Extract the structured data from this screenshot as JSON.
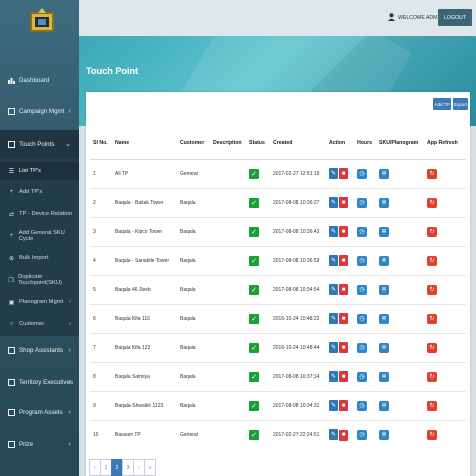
{
  "header": {
    "welcome": "WELCOME ADMIN",
    "logout": "LOGOUT"
  },
  "page": {
    "title": "Touch Point"
  },
  "toolbar": {
    "add": "Add TP",
    "export": "Export"
  },
  "sidebar": {
    "items": [
      {
        "label": "Dashboard"
      },
      {
        "label": "Campaign Mgmt"
      },
      {
        "label": "Touch Points"
      },
      {
        "label": "Shop Assistants"
      },
      {
        "label": "Territory Executives"
      },
      {
        "label": "Program Assets"
      },
      {
        "label": "Prize"
      }
    ],
    "sub": [
      {
        "label": "List TP's"
      },
      {
        "label": "Add TP's"
      },
      {
        "label": "TP - Device Relation"
      },
      {
        "label": "Add General SKU Cycle"
      },
      {
        "label": "Bulk Import"
      },
      {
        "label": "Duplicate Touchpoint(SKU)"
      },
      {
        "label": "Planogram Mgmt"
      },
      {
        "label": "Customer"
      }
    ]
  },
  "table": {
    "headers": [
      "Sl No.",
      "Name",
      "Customer",
      "Description",
      "Status",
      "Created",
      "Action",
      "Hours",
      "SKU/Planogram",
      "App Refresh"
    ],
    "rows": [
      {
        "no": "1",
        "name": "Ali TP",
        "customer": "General",
        "created": "2017-02-27 12:51:19"
      },
      {
        "no": "2",
        "name": "Baqala - Baitak Tower",
        "customer": "Baqala",
        "created": "2017-08-08 10:36:27"
      },
      {
        "no": "3",
        "name": "Baqala - Kipco Tower",
        "customer": "Baqala",
        "created": "2017-08-08 10:36:43"
      },
      {
        "no": "4",
        "name": "Baqala - Sanabile Tower",
        "customer": "Baqala",
        "created": "2017-08-08 10:36:59"
      },
      {
        "no": "5",
        "name": "Baqala 46 Jleeb",
        "customer": "Baqala",
        "created": "2017-08-08 10:34:54"
      },
      {
        "no": "6",
        "name": "Baqala Kifa 116",
        "customer": "Baqala",
        "created": "2016-10-24 10:48:22"
      },
      {
        "no": "7",
        "name": "Baqala Kifa 123",
        "customer": "Baqala",
        "created": "2016-10-24 10:48:44"
      },
      {
        "no": "8",
        "name": "Baqala Salmiya",
        "customer": "Baqala",
        "created": "2017-08-08 10:37:14"
      },
      {
        "no": "9",
        "name": "Baqala-Shwaikh 1123",
        "customer": "Baqala",
        "created": "2017-08-08 10:34:31"
      },
      {
        "no": "10",
        "name": "Bassam TP",
        "customer": "General",
        "created": "2017-02-27 22:24:51"
      }
    ]
  },
  "pagination": {
    "pages": [
      "‹",
      "1",
      "2",
      "3",
      "›",
      "»"
    ],
    "current": "2"
  },
  "colors": {
    "sidebar": "#2f5566",
    "accent": "#3b7ab5",
    "banner": "#3aa9b7"
  }
}
